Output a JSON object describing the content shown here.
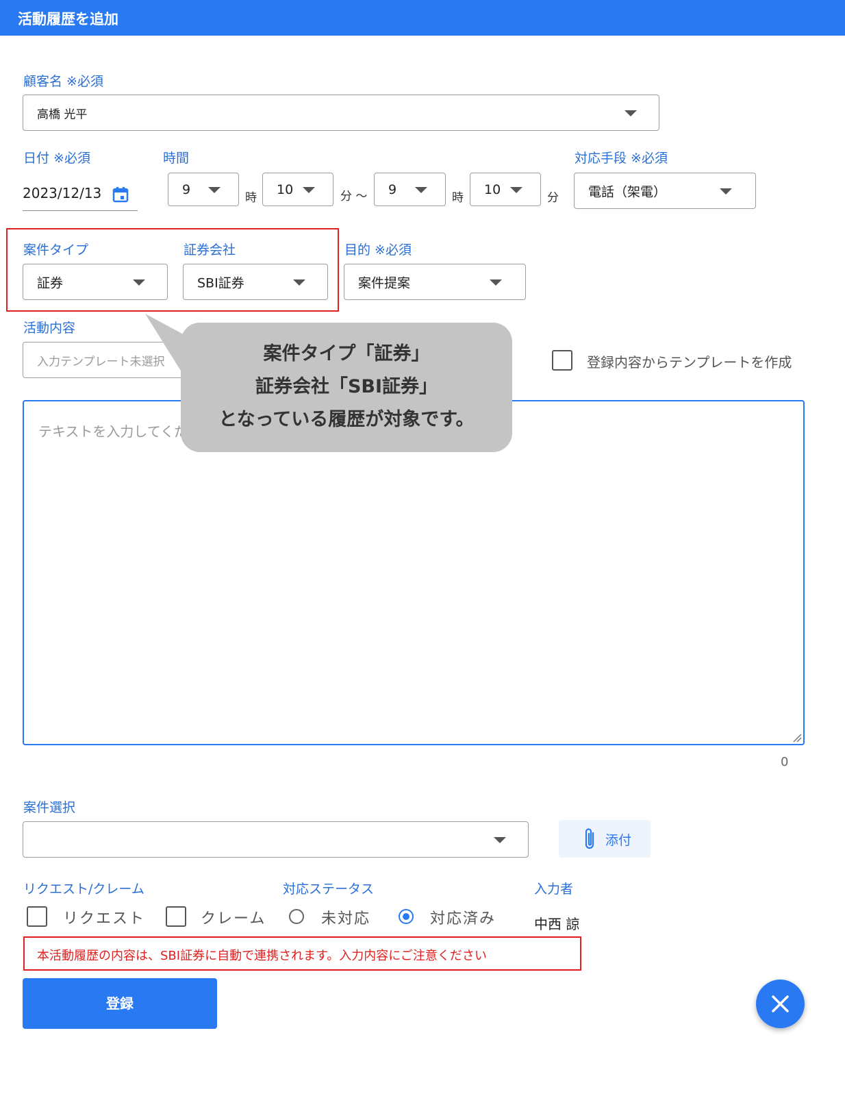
{
  "header": {
    "title": "活動履歴を追加"
  },
  "customer": {
    "label": "顧客名 ※必須",
    "value": "高橋 光平"
  },
  "date": {
    "label": "日付 ※必須",
    "value": "2023/12/13"
  },
  "time": {
    "label": "時間",
    "start_hour": "9",
    "hour_unit": "時",
    "start_minute": "10",
    "minute_unit_tilde": "分 〜",
    "end_hour": "9",
    "end_hour_unit": "時",
    "end_minute": "10",
    "end_minute_unit": "分"
  },
  "method": {
    "label": "対応手段 ※必須",
    "value": "電話（架電）"
  },
  "case_type": {
    "label": "案件タイプ",
    "value": "証券"
  },
  "securities": {
    "label": "証券会社",
    "value": "SBI証券"
  },
  "purpose": {
    "label": "目的 ※必須",
    "value": "案件提案"
  },
  "activity": {
    "label": "活動内容",
    "template_placeholder": "入力テンプレート未選択",
    "template_checkbox_label": "登録内容からテンプレートを作成",
    "text_placeholder": "テキストを入力してください",
    "char_count": "0"
  },
  "callout": {
    "line1": "案件タイプ「証券」",
    "line2": "証券会社「SBI証券」",
    "line3": "となっている履歴が対象です。"
  },
  "case_select": {
    "label": "案件選択",
    "value": ""
  },
  "attach_button": {
    "label": "添付",
    "icon": "paperclip-icon"
  },
  "request": {
    "label": "リクエスト/クレーム",
    "request_label": "リクエスト",
    "request_checked": false,
    "claim_label": "クレーム",
    "claim_checked": false
  },
  "status": {
    "label": "対応ステータス",
    "option_pending": "未対応",
    "option_done": "対応済み",
    "selected": "対応済み"
  },
  "inputter": {
    "label": "入力者",
    "value": "中西 諒"
  },
  "notice": "本活動履歴の内容は、SBI証券に自動で連携されます。入力内容にご注意ください",
  "submit_button": "登録",
  "colors": {
    "primary": "#2979f2",
    "label": "#2a6fd6",
    "highlight": "#e02020",
    "callout": "#c4c4c4"
  }
}
